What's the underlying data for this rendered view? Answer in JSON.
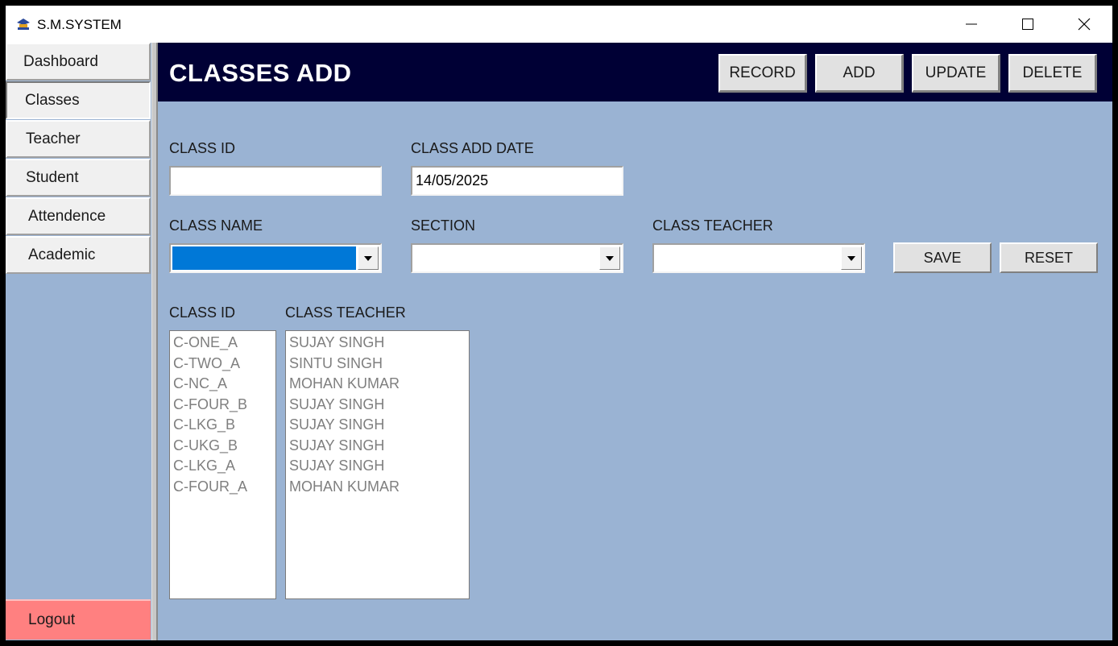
{
  "window": {
    "title": "S.M.SYSTEM",
    "icon": "app-logo-icon"
  },
  "sidebar": {
    "items": [
      {
        "label": "Dashboard"
      },
      {
        "label": "Classes",
        "active": true
      },
      {
        "label": "Teacher"
      },
      {
        "label": "Student"
      },
      {
        "label": "Attendence"
      },
      {
        "label": "Academic"
      }
    ],
    "logout_label": "Logout",
    "logout_color": "#ff8080"
  },
  "header": {
    "title": "CLASSES ADD",
    "background": "#000035",
    "buttons": {
      "record": "RECORD",
      "add": "ADD",
      "update": "UPDATE",
      "delete": "DELETE"
    }
  },
  "form": {
    "class_id_label": "CLASS ID",
    "class_id_value": "",
    "class_add_date_label": "CLASS ADD DATE",
    "class_add_date_value": "14/05/2025",
    "class_name_label": "CLASS NAME",
    "class_name_value": "",
    "section_label": "SECTION",
    "section_value": "",
    "class_teacher_label": "CLASS TEACHER",
    "class_teacher_value": "",
    "save_label": "SAVE",
    "reset_label": "RESET"
  },
  "lists": {
    "class_id_header": "CLASS ID",
    "class_teacher_header": "CLASS TEACHER",
    "class_ids": [
      "C-ONE_A",
      "C-TWO_A",
      "C-NC_A",
      "C-FOUR_B",
      "C-LKG_B",
      "C-UKG_B",
      "C-LKG_A",
      "C-FOUR_A"
    ],
    "class_teachers": [
      "SUJAY SINGH",
      "SINTU SINGH",
      "MOHAN KUMAR",
      "SUJAY SINGH",
      "SUJAY SINGH",
      "SUJAY SINGH",
      "SUJAY SINGH",
      "MOHAN KUMAR"
    ]
  },
  "colors": {
    "content_background": "#9ab3d3",
    "selection": "#0078d7"
  }
}
